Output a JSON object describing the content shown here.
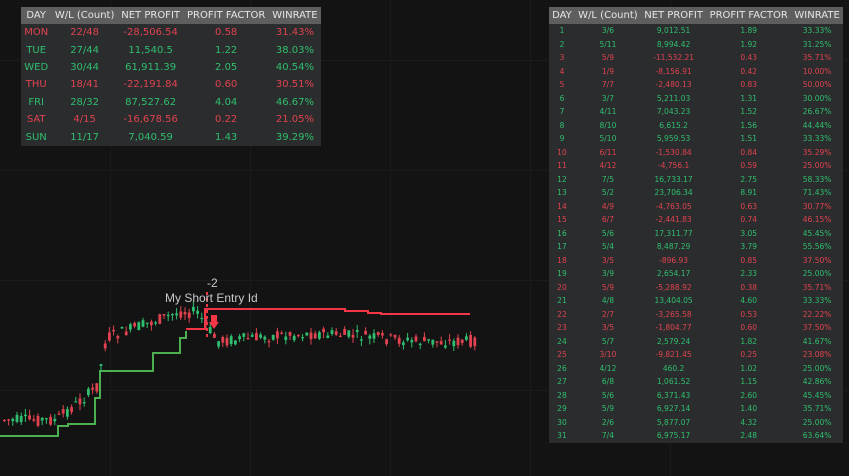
{
  "colors": {
    "background": "#131313",
    "profit": "#2fbf6e",
    "loss": "#e0434f",
    "header_bg": "#5e5e5e",
    "cell_bg": "#2b2c2e",
    "stop_short": "#f23645",
    "stop_long": "#4caf50"
  },
  "day_table": {
    "headers": [
      "DAY",
      "W/L (Count)",
      "NET PROFIT",
      "PROFIT FACTOR",
      "WINRATE"
    ],
    "rows": [
      {
        "day": "MON",
        "wl": "22/48",
        "net": "-28,506.54",
        "pf": "0.58",
        "winrate": "31.43%",
        "status": "loss"
      },
      {
        "day": "TUE",
        "wl": "27/44",
        "net": "11,540.5",
        "pf": "1.22",
        "winrate": "38.03%",
        "status": "profit"
      },
      {
        "day": "WED",
        "wl": "30/44",
        "net": "61,911.39",
        "pf": "2.05",
        "winrate": "40.54%",
        "status": "profit"
      },
      {
        "day": "THU",
        "wl": "18/41",
        "net": "-22,191.84",
        "pf": "0.60",
        "winrate": "30.51%",
        "status": "loss"
      },
      {
        "day": "FRI",
        "wl": "28/32",
        "net": "87,527.62",
        "pf": "4.04",
        "winrate": "46.67%",
        "status": "profit"
      },
      {
        "day": "SAT",
        "wl": "4/15",
        "net": "-16,678.56",
        "pf": "0.22",
        "winrate": "21.05%",
        "status": "loss"
      },
      {
        "day": "SUN",
        "wl": "11/17",
        "net": "7,040.59",
        "pf": "1.43",
        "winrate": "39.29%",
        "status": "profit"
      }
    ]
  },
  "date_table": {
    "headers": [
      "DAY",
      "W/L (Count)",
      "NET PROFIT",
      "PROFIT FACTOR",
      "WINRATE"
    ],
    "rows": [
      {
        "day": "1",
        "wl": "3/6",
        "net": "9,012.51",
        "pf": "1.89",
        "winrate": "33.33%",
        "status": "profit"
      },
      {
        "day": "2",
        "wl": "5/11",
        "net": "8,994.42",
        "pf": "1.92",
        "winrate": "31.25%",
        "status": "profit"
      },
      {
        "day": "3",
        "wl": "5/9",
        "net": "-11,532.21",
        "pf": "0.43",
        "winrate": "35.71%",
        "status": "loss"
      },
      {
        "day": "4",
        "wl": "1/9",
        "net": "-8,156.91",
        "pf": "0.42",
        "winrate": "10.00%",
        "status": "loss"
      },
      {
        "day": "5",
        "wl": "7/7",
        "net": "-2,480.13",
        "pf": "0.83",
        "winrate": "50.00%",
        "status": "loss"
      },
      {
        "day": "6",
        "wl": "3/7",
        "net": "5,211.03",
        "pf": "1.31",
        "winrate": "30.00%",
        "status": "profit"
      },
      {
        "day": "7",
        "wl": "4/11",
        "net": "7,043.23",
        "pf": "1.52",
        "winrate": "26.67%",
        "status": "profit"
      },
      {
        "day": "8",
        "wl": "8/10",
        "net": "6,615.2",
        "pf": "1.56",
        "winrate": "44.44%",
        "status": "profit"
      },
      {
        "day": "9",
        "wl": "5/10",
        "net": "5,959.53",
        "pf": "1.51",
        "winrate": "33.33%",
        "status": "profit"
      },
      {
        "day": "10",
        "wl": "6/11",
        "net": "-1,530.84",
        "pf": "0.84",
        "winrate": "35.29%",
        "status": "loss"
      },
      {
        "day": "11",
        "wl": "4/12",
        "net": "-4,756.1",
        "pf": "0.59",
        "winrate": "25.00%",
        "status": "loss"
      },
      {
        "day": "12",
        "wl": "7/5",
        "net": "16,733.17",
        "pf": "2.75",
        "winrate": "58.33%",
        "status": "profit"
      },
      {
        "day": "13",
        "wl": "5/2",
        "net": "23,706.34",
        "pf": "8.91",
        "winrate": "71.43%",
        "status": "profit"
      },
      {
        "day": "14",
        "wl": "4/9",
        "net": "-4,763.05",
        "pf": "0.63",
        "winrate": "30.77%",
        "status": "loss"
      },
      {
        "day": "15",
        "wl": "6/7",
        "net": "-2,441.83",
        "pf": "0.74",
        "winrate": "46.15%",
        "status": "loss"
      },
      {
        "day": "16",
        "wl": "5/6",
        "net": "17,311.77",
        "pf": "3.05",
        "winrate": "45.45%",
        "status": "profit"
      },
      {
        "day": "17",
        "wl": "5/4",
        "net": "8,487.29",
        "pf": "3.79",
        "winrate": "55.56%",
        "status": "profit"
      },
      {
        "day": "18",
        "wl": "3/5",
        "net": "-896.93",
        "pf": "0.85",
        "winrate": "37.50%",
        "status": "loss"
      },
      {
        "day": "19",
        "wl": "3/9",
        "net": "2,654.17",
        "pf": "2.33",
        "winrate": "25.00%",
        "status": "profit"
      },
      {
        "day": "20",
        "wl": "5/9",
        "net": "-5,288.92",
        "pf": "0.38",
        "winrate": "35.71%",
        "status": "loss"
      },
      {
        "day": "21",
        "wl": "4/8",
        "net": "13,404.05",
        "pf": "4.60",
        "winrate": "33.33%",
        "status": "profit"
      },
      {
        "day": "22",
        "wl": "2/7",
        "net": "-3,265.58",
        "pf": "0.53",
        "winrate": "22.22%",
        "status": "loss"
      },
      {
        "day": "23",
        "wl": "3/5",
        "net": "-1,804.77",
        "pf": "0.60",
        "winrate": "37.50%",
        "status": "loss"
      },
      {
        "day": "24",
        "wl": "5/7",
        "net": "2,579.24",
        "pf": "1.82",
        "winrate": "41.67%",
        "status": "profit"
      },
      {
        "day": "25",
        "wl": "3/10",
        "net": "-9,821.45",
        "pf": "0.25",
        "winrate": "23.08%",
        "status": "loss"
      },
      {
        "day": "26",
        "wl": "4/12",
        "net": "460.2",
        "pf": "1.02",
        "winrate": "25.00%",
        "status": "profit"
      },
      {
        "day": "27",
        "wl": "6/8",
        "net": "1,061.52",
        "pf": "1.15",
        "winrate": "42.86%",
        "status": "profit"
      },
      {
        "day": "28",
        "wl": "5/6",
        "net": "6,371.43",
        "pf": "2.60",
        "winrate": "45.45%",
        "status": "profit"
      },
      {
        "day": "29",
        "wl": "5/9",
        "net": "6,927.14",
        "pf": "1.40",
        "winrate": "35.71%",
        "status": "profit"
      },
      {
        "day": "30",
        "wl": "2/6",
        "net": "5,877.07",
        "pf": "4.32",
        "winrate": "25.00%",
        "status": "profit"
      },
      {
        "day": "31",
        "wl": "7/4",
        "net": "6,975.17",
        "pf": "2.48",
        "winrate": "63.64%",
        "status": "profit"
      }
    ]
  },
  "chart": {
    "trade_qty_label": "-2",
    "entry_label": "My Short Entry Id"
  }
}
